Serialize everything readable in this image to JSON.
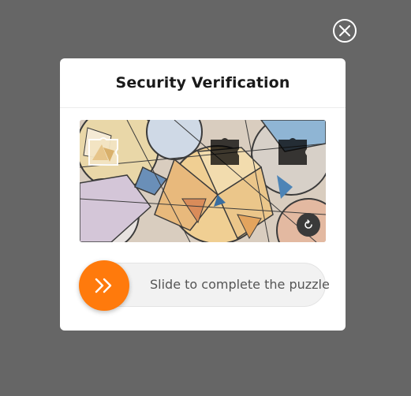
{
  "modal": {
    "title": "Security Verification",
    "slider_label": "Slide to complete the puzzle"
  },
  "colors": {
    "overlay": "#666666",
    "accent": "#ff7a0c",
    "refresh_bg": "#3a3a3a"
  },
  "icons": {
    "close": "close-icon",
    "refresh": "refresh-icon",
    "slider": "double-chevron-right-icon"
  }
}
